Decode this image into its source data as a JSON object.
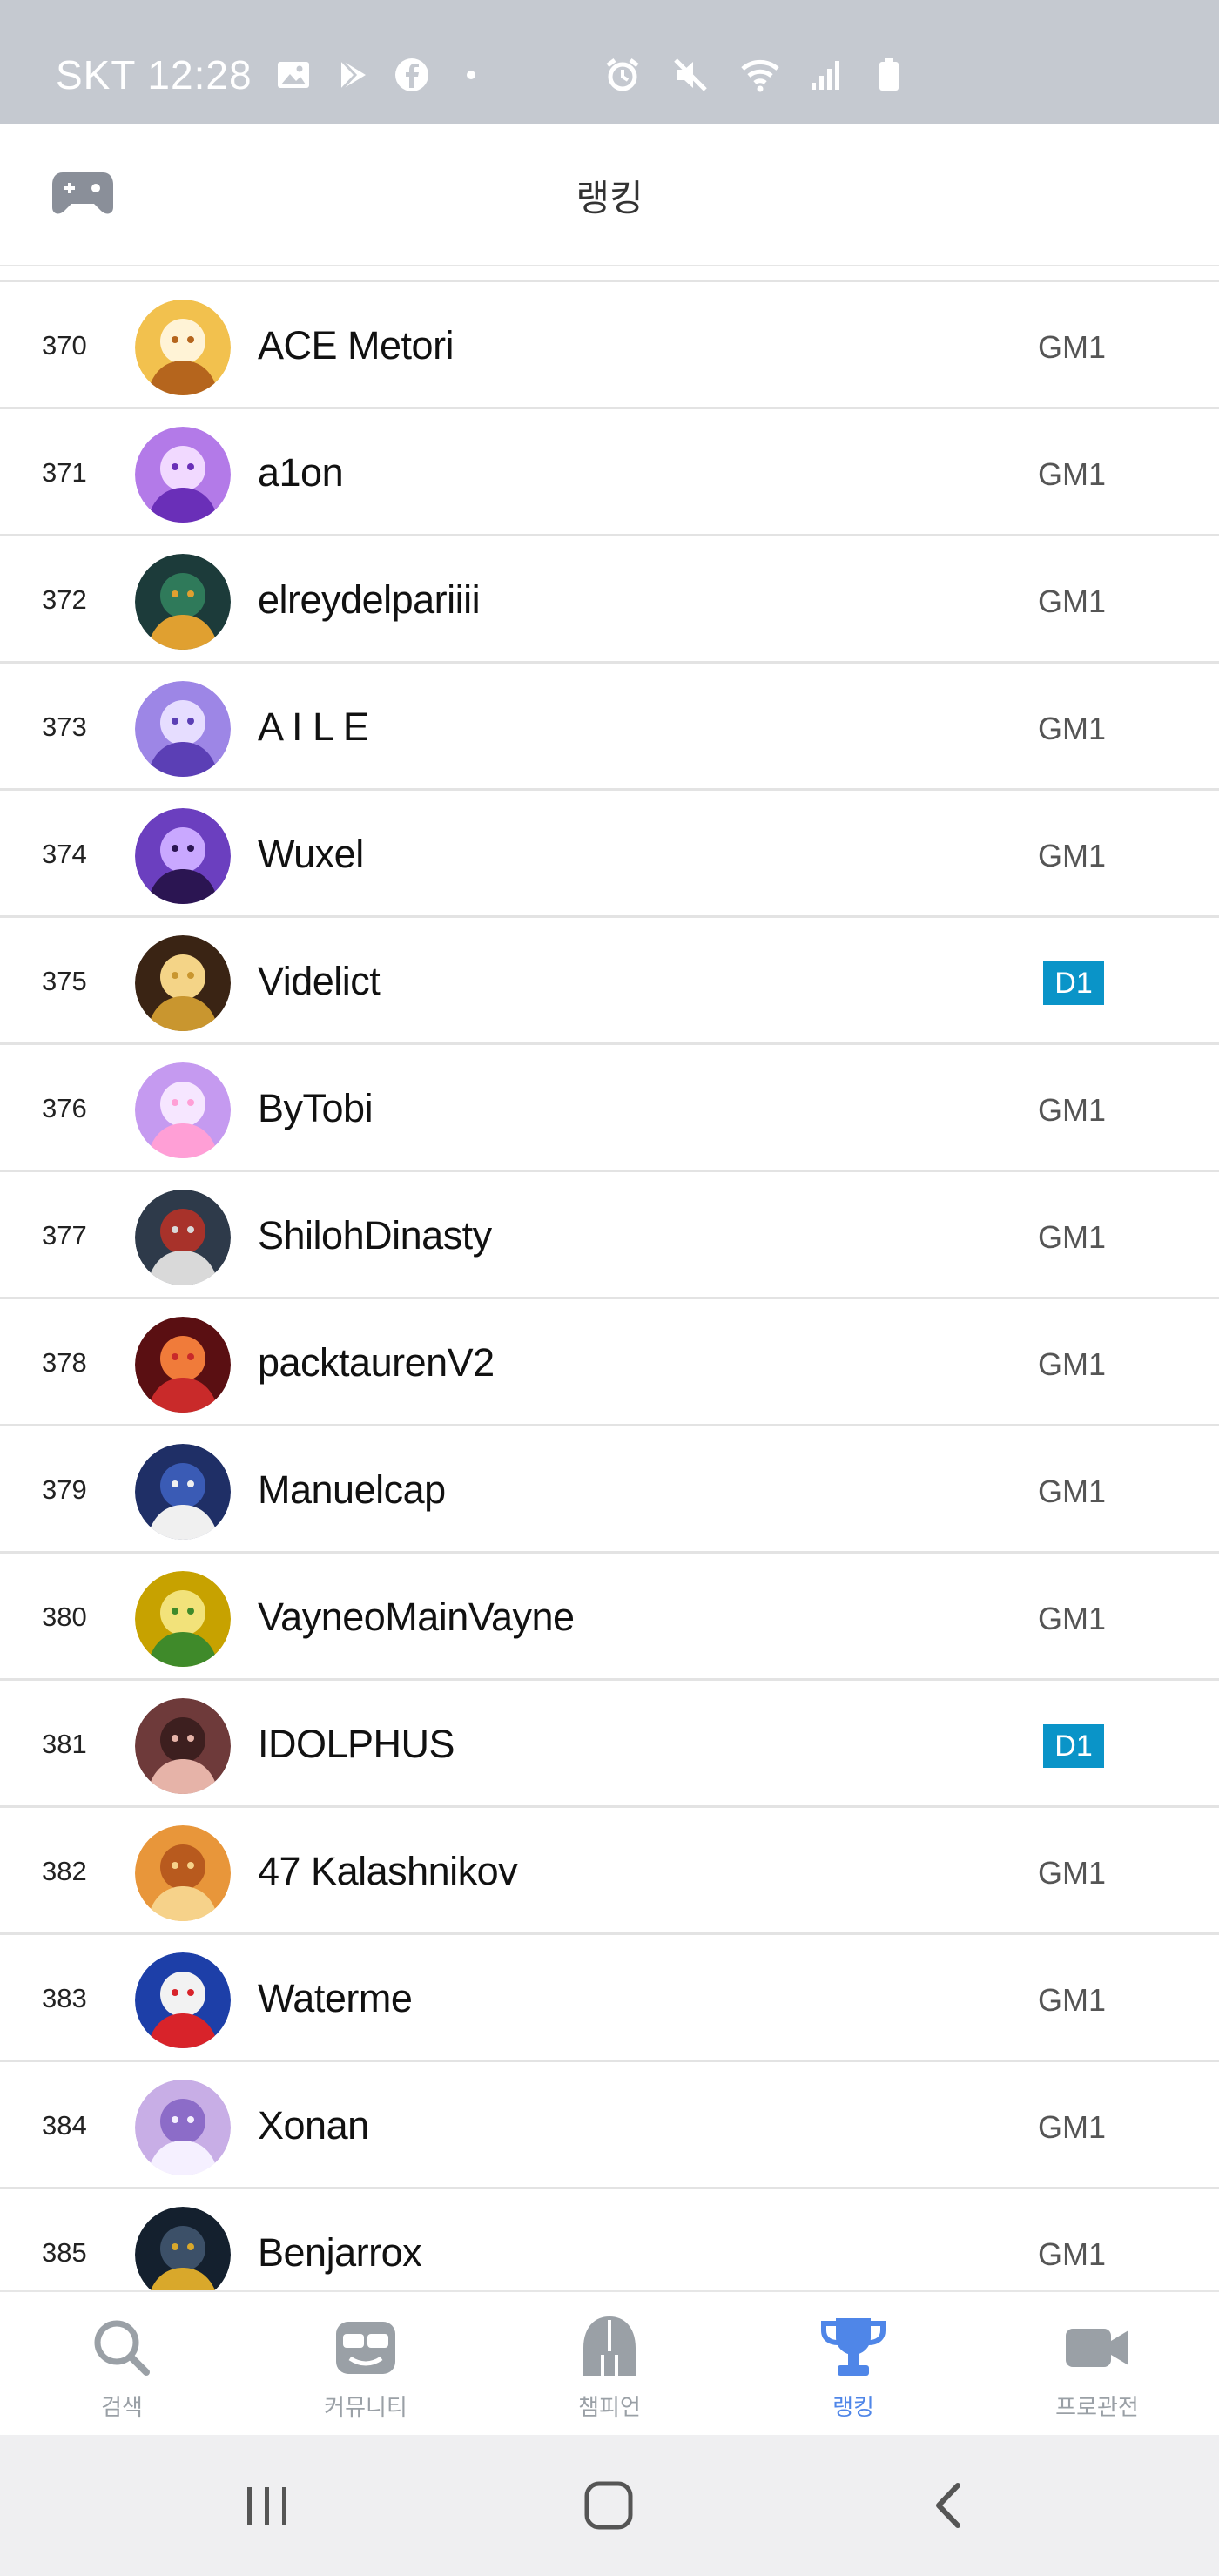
{
  "status_bar": {
    "carrier": "SKT",
    "time": "12:28",
    "left_icons": [
      "gallery-icon",
      "play-store-icon",
      "facebook-icon",
      "dot-icon"
    ],
    "right_icons": [
      "alarm-icon",
      "mute-icon",
      "wifi-icon",
      "signal-icon",
      "battery-icon"
    ]
  },
  "header": {
    "title": "랭킹",
    "left_icon": "gamepad-icon"
  },
  "tier_colors": {
    "GM1": "#555555",
    "D1": "#0a94c8"
  },
  "rankings": [
    {
      "rank": "370",
      "name": "ACE Metori",
      "tier": "GM1",
      "avatar": "dog-avatar"
    },
    {
      "rank": "371",
      "name": "a1on",
      "tier": "GM1",
      "avatar": "purple-girl-avatar"
    },
    {
      "rank": "372",
      "name": "elreydelpariiii",
      "tier": "GM1",
      "avatar": "bird-avatar"
    },
    {
      "rank": "373",
      "name": "A I L E",
      "tier": "GM1",
      "avatar": "violet-girl-avatar"
    },
    {
      "rank": "374",
      "name": "Wuxel",
      "tier": "GM1",
      "avatar": "dark-purple-avatar"
    },
    {
      "rank": "375",
      "name": "Videlict",
      "tier": "D1",
      "avatar": "gold-emblem-avatar"
    },
    {
      "rank": "376",
      "name": "ByTobi",
      "tier": "GM1",
      "avatar": "pink-girl-avatar"
    },
    {
      "rank": "377",
      "name": "ShilohDinasty",
      "tier": "GM1",
      "avatar": "skull-avatar"
    },
    {
      "rank": "378",
      "name": "packtaurenV2",
      "tier": "GM1",
      "avatar": "red-dragon-avatar"
    },
    {
      "rank": "379",
      "name": "Manuelcap",
      "tier": "GM1",
      "avatar": "penguin-avatar"
    },
    {
      "rank": "380",
      "name": "VayneoMainVayne",
      "tier": "GM1",
      "avatar": "sprout-avatar"
    },
    {
      "rank": "381",
      "name": "IDOLPHUS",
      "tier": "D1",
      "avatar": "brunette-girl-avatar"
    },
    {
      "rank": "382",
      "name": "47 Kalashnikov",
      "tier": "GM1",
      "avatar": "orange-girl-avatar"
    },
    {
      "rank": "383",
      "name": "Waterme",
      "tier": "GM1",
      "avatar": "clown-avatar"
    },
    {
      "rank": "384",
      "name": "Xonan",
      "tier": "GM1",
      "avatar": "white-hair-avatar"
    },
    {
      "rank": "385",
      "name": "Benjarrox",
      "tier": "GM1",
      "avatar": "coin-avatar"
    }
  ],
  "bottom_nav": [
    {
      "label": "검색",
      "icon": "search-icon",
      "active": false
    },
    {
      "label": "커뮤니티",
      "icon": "community-icon",
      "active": false
    },
    {
      "label": "챔피언",
      "icon": "champion-helmet-icon",
      "active": false
    },
    {
      "label": "랭킹",
      "icon": "trophy-icon",
      "active": true
    },
    {
      "label": "프로관전",
      "icon": "video-camera-icon",
      "active": false
    }
  ],
  "nav_colors": {
    "active": "#4f86e8",
    "inactive": "#9aa0a6"
  },
  "system_nav": [
    "recent-apps-icon",
    "home-icon",
    "back-icon"
  ]
}
